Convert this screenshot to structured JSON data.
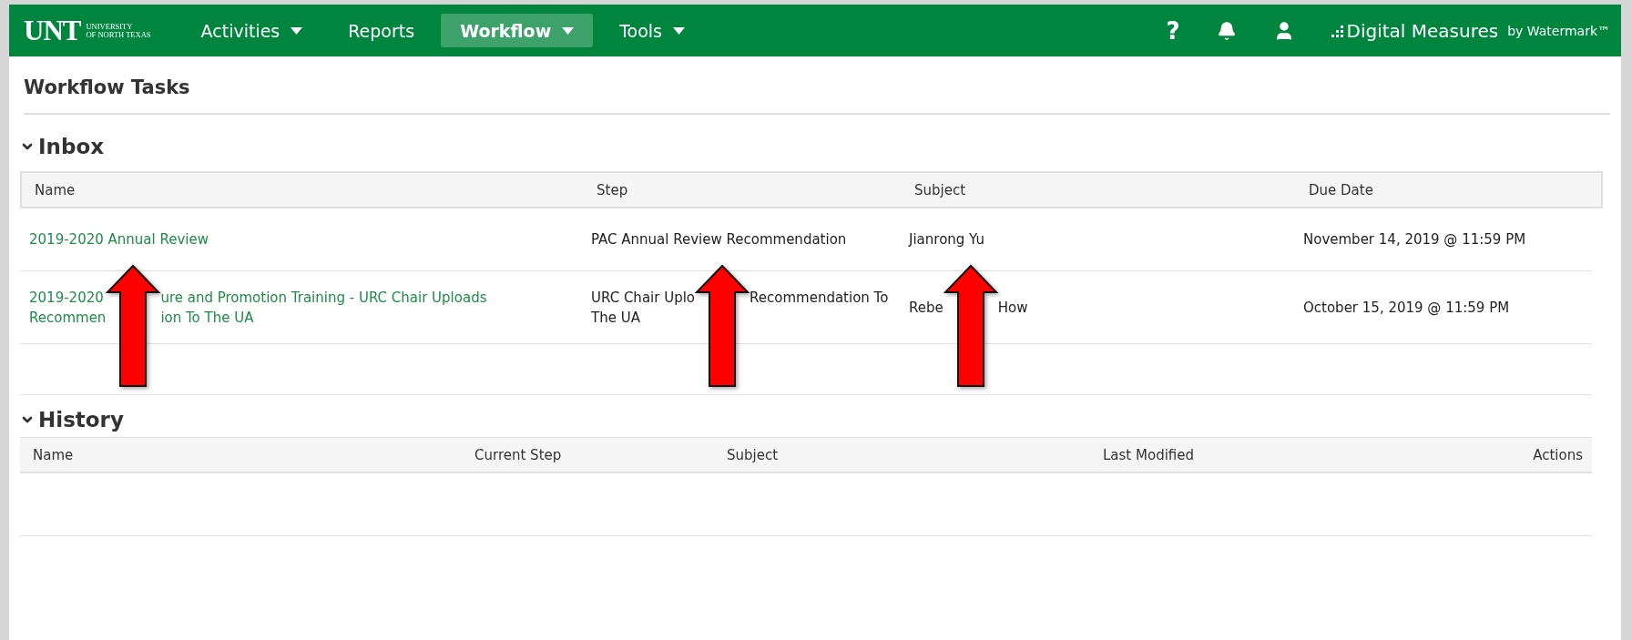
{
  "header": {
    "logo": {
      "mark": "UNT",
      "line1": "UNIVERSITY",
      "line2": "OF NORTH TEXAS"
    },
    "nav": [
      {
        "label": "Activities",
        "selected": false,
        "dropdown": true
      },
      {
        "label": "Reports",
        "selected": false,
        "dropdown": false
      },
      {
        "label": "Workflow",
        "selected": true,
        "dropdown": true
      },
      {
        "label": "Tools",
        "selected": false,
        "dropdown": true
      }
    ],
    "help": "?",
    "brand": {
      "name": "Digital Measures",
      "by": "by Watermark™"
    }
  },
  "page_title": "Workflow Tasks",
  "inbox": {
    "title": "Inbox",
    "expanded": true,
    "columns": [
      "Name",
      "Step",
      "Subject",
      "Due Date"
    ],
    "rows": [
      {
        "name": [
          [
            "2019-2020 Annual Review"
          ]
        ],
        "step": [
          [
            "PAC Annual Review Recommendation"
          ]
        ],
        "subject": [
          [
            "Jianrong Yu"
          ]
        ],
        "due_date": [
          [
            "November 14, 2019 @ 11:59 PM"
          ]
        ]
      },
      {
        "name": [
          [
            "2019-2020",
            "ure and Promotion Training - URC Chair Uploads"
          ],
          [
            "Recommen",
            "ion To The UA"
          ]
        ],
        "step": [
          [
            "URC Chair Uplo",
            "Recommendation To"
          ],
          [
            "The UA"
          ]
        ],
        "subject": [
          [
            "Rebe",
            "How"
          ]
        ],
        "due_date": [
          [
            "October 15, 2019 @ 11:59 PM"
          ]
        ]
      }
    ]
  },
  "history": {
    "title": "History",
    "expanded": true,
    "columns": [
      "Name",
      "Current Step",
      "Subject",
      "Last Modified",
      "Actions"
    ]
  }
}
